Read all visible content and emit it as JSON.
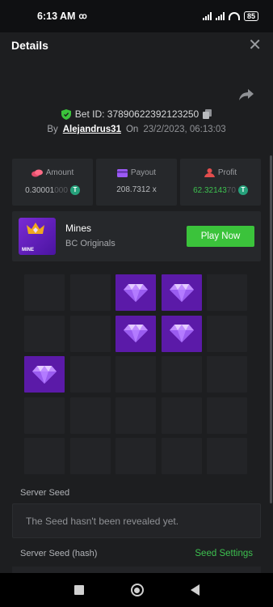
{
  "status_bar": {
    "time": "6:13 AM",
    "battery": "85"
  },
  "header": {
    "title": "Details",
    "close": "✕"
  },
  "bet": {
    "id_label": "Bet ID: 37890622392123250",
    "by_label": "By",
    "username": "Alejandrus31",
    "on_label": "On",
    "datetime": "23/2/2023, 06:13:03"
  },
  "stats": {
    "amount": {
      "label": "Amount",
      "value": "0.30001",
      "value_faded": "000"
    },
    "payout": {
      "label": "Payout",
      "value": "208.7312 x"
    },
    "profit": {
      "label": "Profit",
      "value": "62.32143",
      "value_faded": "70"
    }
  },
  "currency_icon": "T",
  "game": {
    "name": "Mines",
    "provider": "BC Originals",
    "thumb_text": "MINE",
    "play_label": "Play Now"
  },
  "board": [
    [
      0,
      0,
      1,
      1,
      0
    ],
    [
      0,
      0,
      1,
      1,
      0
    ],
    [
      1,
      0,
      0,
      0,
      0
    ],
    [
      0,
      0,
      0,
      0,
      0
    ],
    [
      0,
      0,
      0,
      0,
      0
    ]
  ],
  "seeds": {
    "server_seed_label": "Server Seed",
    "server_seed_value": "The Seed hasn't been revealed yet.",
    "server_hash_label": "Server Seed (hash)",
    "settings_label": "Seed Settings"
  },
  "colors": {
    "accent_green": "#3bc33b",
    "gem_purple": "#5b1aa8",
    "panel": "#26282b"
  }
}
